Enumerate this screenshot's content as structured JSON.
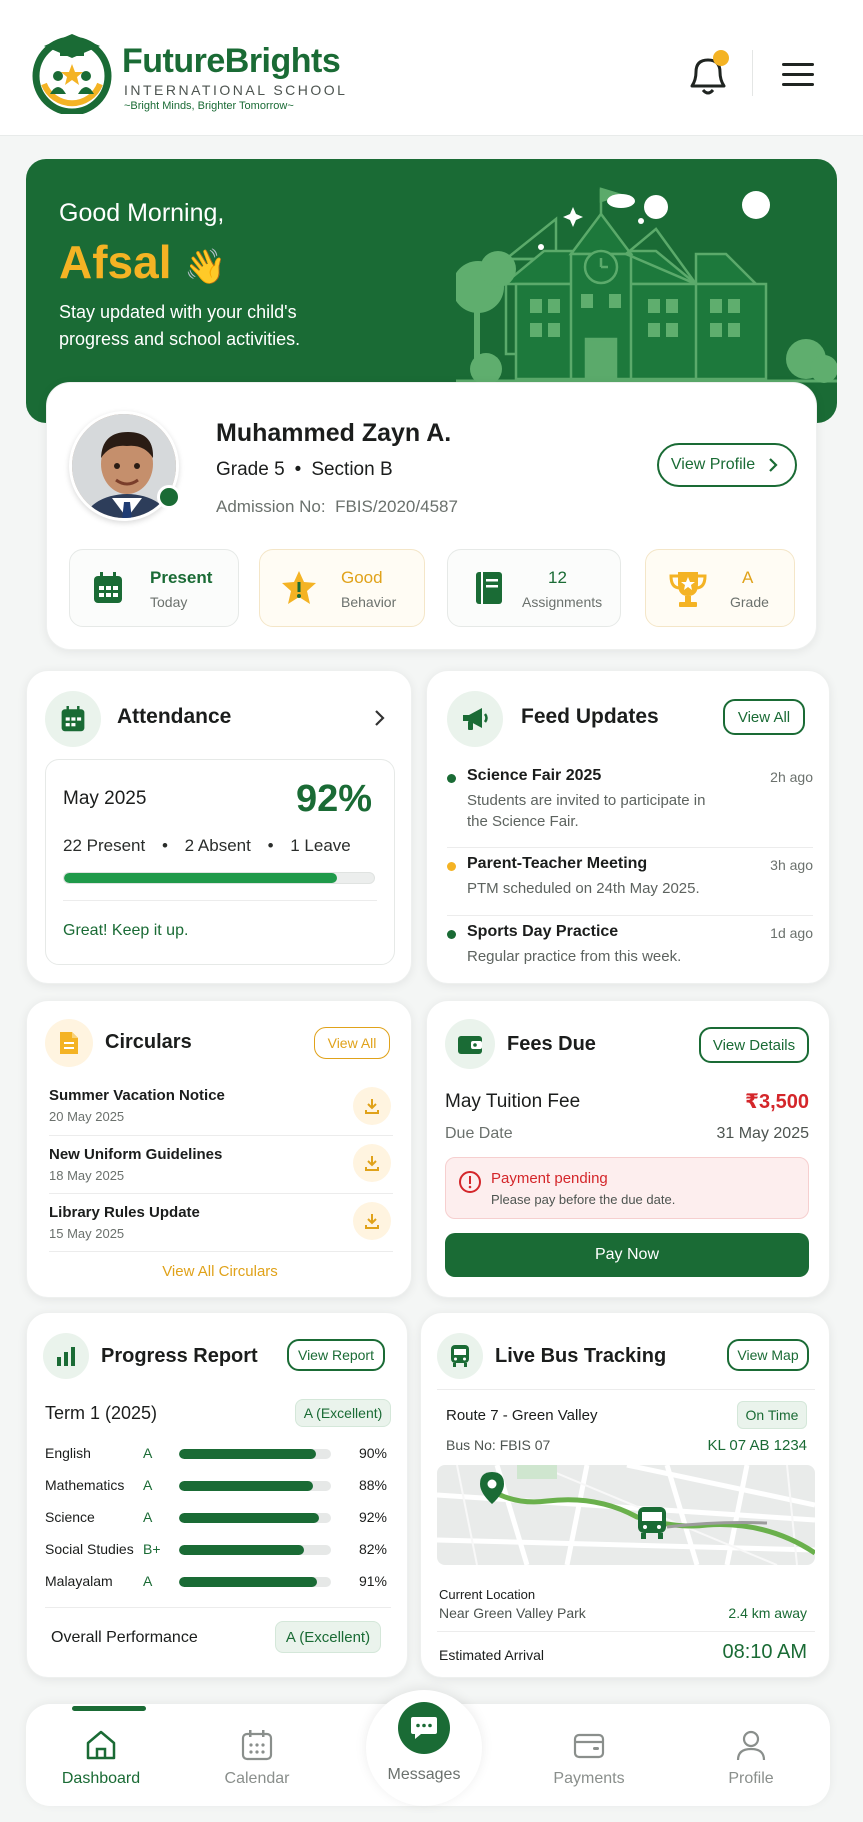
{
  "colors": {
    "primary": "#1a6b35",
    "accent": "#f4b324",
    "danger": "#d4262a",
    "bg": "#f4f6f5"
  },
  "header": {
    "brand": "FutureBrights",
    "sub": "INTERNATIONAL SCHOOL",
    "tagline": "~Bright Minds, Brighter Tomorrow~",
    "icons": [
      "bell-icon",
      "menu-icon"
    ]
  },
  "hero": {
    "greeting": "Good Morning,",
    "name": "Afsal",
    "wave": "👋",
    "line1": "Stay updated with your child's",
    "line2": "progress and school activities."
  },
  "student": {
    "name": "Muhammed Zayn A.",
    "grade": "Grade 5",
    "section": "Section B",
    "admission_label": "Admission No:",
    "admission_no": "FBIS/2020/4587",
    "view_profile": "View Profile",
    "stats": [
      {
        "value": "Present",
        "label": "Today",
        "icon": "calendar-icon"
      },
      {
        "value": "Good",
        "label": "Behavior",
        "icon": "star-icon"
      },
      {
        "value": "12",
        "label": "Assignments",
        "icon": "book-icon"
      },
      {
        "value": "A",
        "label": "Grade",
        "icon": "trophy-icon"
      }
    ]
  },
  "attendance": {
    "title": "Attendance",
    "month": "May 2025",
    "percent": "92%",
    "progress": 0.88,
    "present": "22 Present",
    "absent": "2 Absent",
    "leave": "1 Leave",
    "dot": "•",
    "note": "Great! Keep it up."
  },
  "feed": {
    "title": "Feed Updates",
    "view_all": "View All",
    "items": [
      {
        "title": "Science Fair 2025",
        "time": "2h ago",
        "desc1": "Students are invited to participate in",
        "desc2": "the Science Fair.",
        "color": "#1a6b35"
      },
      {
        "title": "Parent-Teacher Meeting",
        "time": "3h ago",
        "desc1": "PTM scheduled on 24th May 2025.",
        "desc2": "",
        "color": "#f4b324"
      },
      {
        "title": "Sports Day Practice",
        "time": "1d ago",
        "desc1": "Regular practice from this week.",
        "desc2": "",
        "color": "#1a6b35"
      }
    ]
  },
  "circulars": {
    "title": "Circulars",
    "view_all": "View All",
    "footer": "View All Circulars",
    "items": [
      {
        "title": "Summer Vacation Notice",
        "date": "20 May 2025"
      },
      {
        "title": "New Uniform Guidelines",
        "date": "18 May 2025"
      },
      {
        "title": "Library Rules Update",
        "date": "15 May 2025"
      }
    ]
  },
  "fees": {
    "title": "Fees Due",
    "view_details": "View Details",
    "item": "May Tuition Fee",
    "amount": "₹3,500",
    "due_label": "Due Date",
    "due_date": "31 May 2025",
    "alert_title": "Payment pending",
    "alert_sub": "Please pay before the due date.",
    "pay": "Pay Now"
  },
  "progress": {
    "title": "Progress Report",
    "view_report": "View Report",
    "term": "Term 1 (2025)",
    "term_grade": "A (Excellent)",
    "overall_label": "Overall Performance",
    "overall": "A (Excellent)",
    "subjects": [
      {
        "name": "English",
        "grade": "A",
        "pct": "90%",
        "value": 0.9
      },
      {
        "name": "Mathematics",
        "grade": "A",
        "pct": "88%",
        "value": 0.88
      },
      {
        "name": "Science",
        "grade": "A",
        "pct": "92%",
        "value": 0.92
      },
      {
        "name": "Social Studies",
        "grade": "B+",
        "pct": "82%",
        "value": 0.82
      },
      {
        "name": "Malayalam",
        "grade": "A",
        "pct": "91%",
        "value": 0.91
      }
    ]
  },
  "bus": {
    "title": "Live Bus Tracking",
    "view_map": "View Map",
    "route": "Route 7 - Green Valley",
    "status": "On Time",
    "bus_no": "Bus No: FBIS 07",
    "plate": "KL 07 AB 1234",
    "loc_label": "Current Location",
    "loc": "Near Green Valley Park",
    "distance": "2.4 km away",
    "eta_label": "Estimated Arrival",
    "eta": "08:10 AM"
  },
  "nav": {
    "items": [
      {
        "label": "Dashboard",
        "icon": "home-icon"
      },
      {
        "label": "Calendar",
        "icon": "calendar-icon"
      },
      {
        "label": "Messages",
        "icon": "chat-icon"
      },
      {
        "label": "Payments",
        "icon": "wallet-icon"
      },
      {
        "label": "Profile",
        "icon": "user-icon"
      }
    ]
  }
}
